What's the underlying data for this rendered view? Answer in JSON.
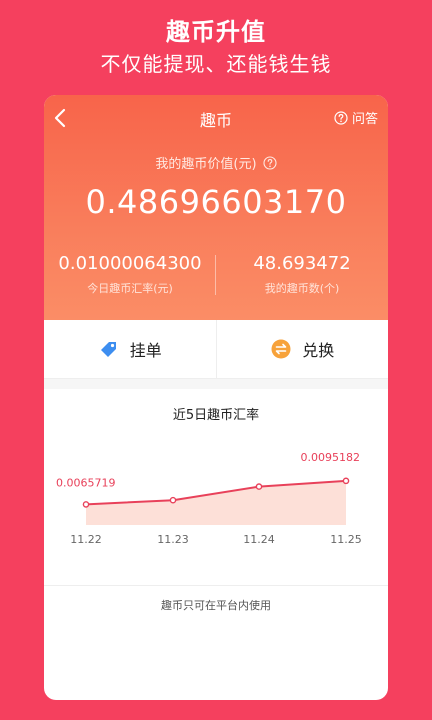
{
  "promo": {
    "title": "趣币升值",
    "subtitle": "不仅能提现、还能钱生钱"
  },
  "header": {
    "title": "趣币",
    "qa_label": "问答"
  },
  "value": {
    "label": "我的趣币价值(元)",
    "amount": "0.48696603170"
  },
  "stats": {
    "rate_value": "0.01000064300",
    "rate_label": "今日趣币汇率(元)",
    "count_value": "48.693472",
    "count_label": "我的趣币数(个)"
  },
  "actions": {
    "list_label": "挂单",
    "exchange_label": "兑换"
  },
  "chart_data": {
    "type": "area",
    "title": "近5日趣币汇率",
    "categories": [
      "11.22",
      "11.23",
      "11.24",
      "11.25"
    ],
    "values": [
      0.0065719,
      0.0071,
      0.0088,
      0.0095182
    ],
    "annotations": [
      {
        "category": "11.22",
        "label": "0.0065719"
      },
      {
        "category": "11.25",
        "label": "0.0095182"
      }
    ],
    "ylim": [
      0.004,
      0.0115
    ],
    "grid": false,
    "legend": "none"
  },
  "footnote": "趣币只可在平台内使用",
  "colors": {
    "background": "#f5405e",
    "line": "#e8415a",
    "fill": "#fde0d8",
    "accent_blue": "#3d8ef0",
    "accent_orange": "#f7a23a"
  }
}
